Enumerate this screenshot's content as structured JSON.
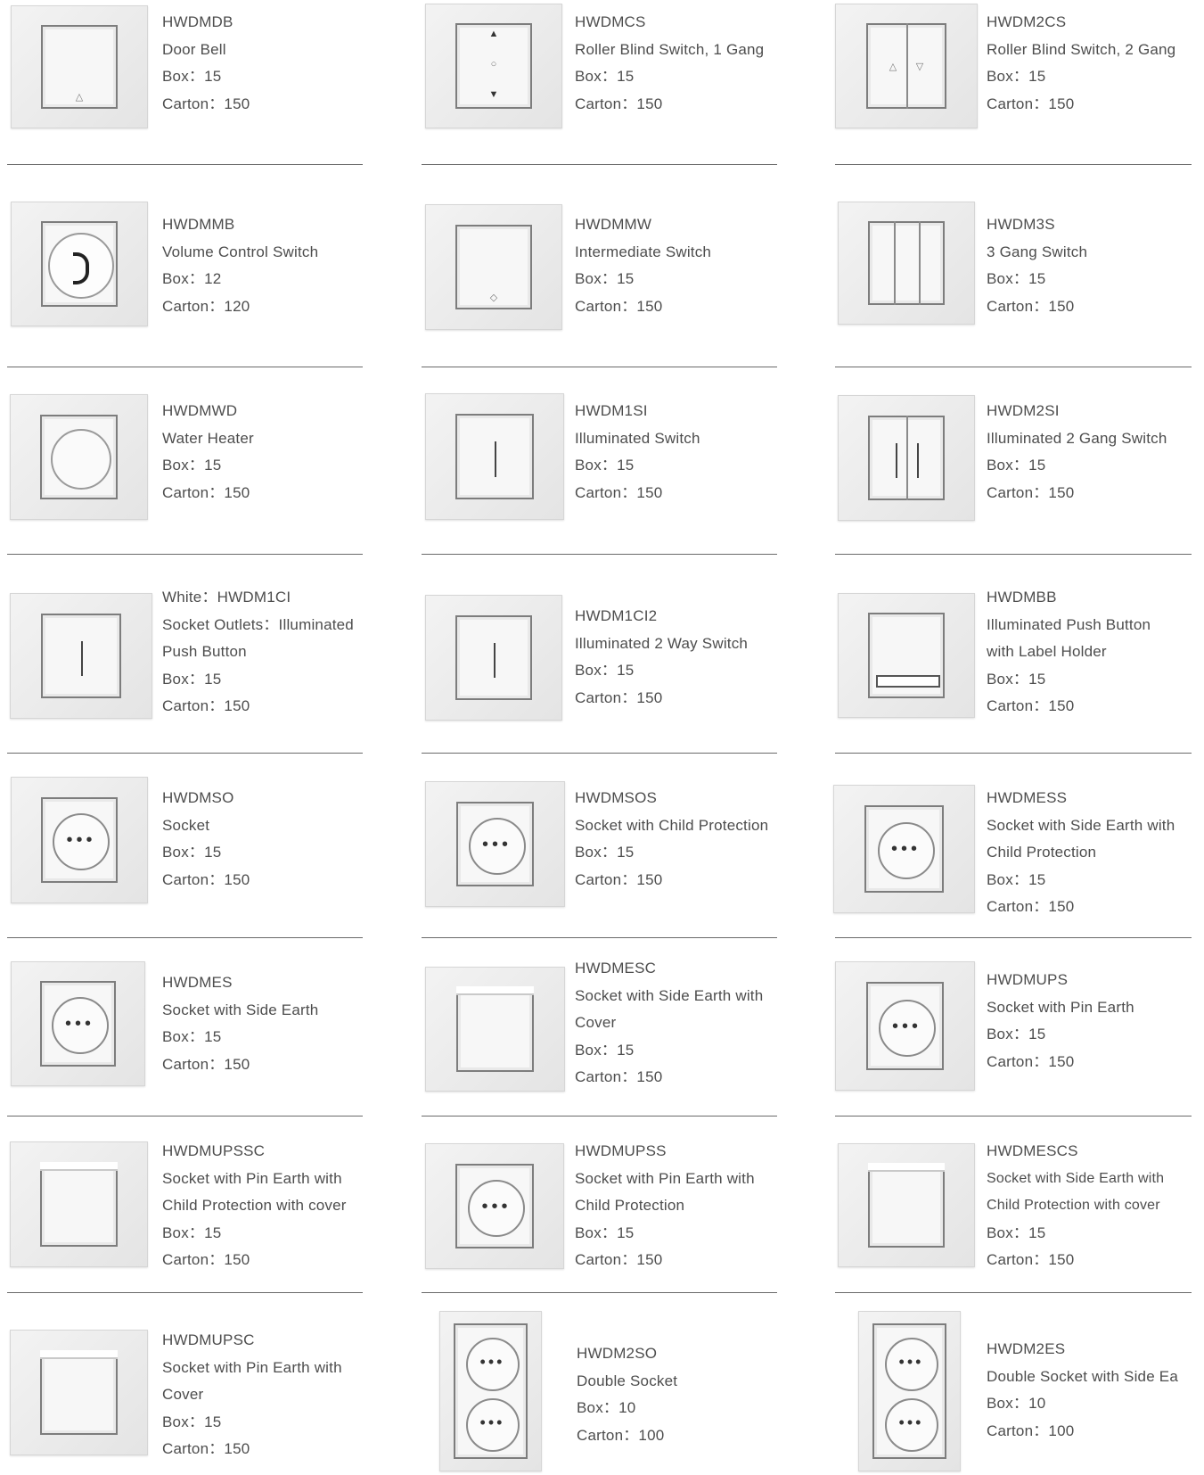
{
  "products": [
    {
      "code": "HWDMDB",
      "name": [
        "Door Bell"
      ],
      "box": "Box：15",
      "carton": "Carton：150",
      "icon": "door-bell-icon"
    },
    {
      "code": "HWDMCS",
      "name": [
        "Roller Blind Switch, 1 Gang"
      ],
      "box": "Box：15",
      "carton": "Carton：150",
      "icon": "roller-blind-1-gang-icon"
    },
    {
      "code": "HWDM2CS",
      "name": [
        "Roller Blind Switch, 2 Gang"
      ],
      "box": "Box：15",
      "carton": "Carton：150",
      "icon": "roller-blind-2-gang-icon"
    },
    {
      "code": "HWDMMB",
      "name": [
        "Volume Control Switch"
      ],
      "box": "Box：12",
      "carton": "Carton：120",
      "icon": "volume-control-dial-icon"
    },
    {
      "code": "HWDMMW",
      "name": [
        "Intermediate Switch"
      ],
      "box": "Box：15",
      "carton": "Carton：150",
      "icon": "intermediate-switch-icon"
    },
    {
      "code": "HWDM3S",
      "name": [
        "3 Gang Switch"
      ],
      "box": "Box：15",
      "carton": "Carton：150",
      "icon": "three-gang-switch-icon"
    },
    {
      "code": "HWDMWD",
      "name": [
        "Water Heater"
      ],
      "box": "Box：15",
      "carton": "Carton：150",
      "icon": "water-heater-knob-icon"
    },
    {
      "code": "HWDM1SI",
      "name": [
        "Illuminated Switch"
      ],
      "box": "Box：15",
      "carton": "Carton：150",
      "icon": "illuminated-switch-icon"
    },
    {
      "code": "HWDM2SI",
      "name": [
        "Illuminated 2 Gang Switch"
      ],
      "box": "Box：15",
      "carton": "Carton：150",
      "icon": "illuminated-2-gang-switch-icon"
    },
    {
      "code": "White：HWDM1CI",
      "name": [
        "Socket Outlets：Illuminated",
        "Push Button"
      ],
      "box": "Box：15",
      "carton": "Carton：150",
      "icon": "illuminated-push-button-icon"
    },
    {
      "code": "HWDM1CI2",
      "name": [
        "Illuminated 2 Way Switch"
      ],
      "box": "Box：15",
      "carton": "Carton：150",
      "icon": "illuminated-2-way-switch-icon"
    },
    {
      "code": "HWDMBB",
      "name": [
        "Illuminated Push Button",
        "with Label Holder"
      ],
      "box": "Box：15",
      "carton": "Carton：150",
      "icon": "push-button-label-holder-icon"
    },
    {
      "code": "HWDMSO",
      "name": [
        "Socket"
      ],
      "box": "Box：15",
      "carton": "Carton：150",
      "icon": "socket-icon"
    },
    {
      "code": "HWDMSOS",
      "name": [
        "Socket with Child Protection"
      ],
      "box": "Box：15",
      "carton": "Carton：150",
      "icon": "socket-child-protection-icon"
    },
    {
      "code": "HWDMESS",
      "name": [
        "Socket with Side Earth with",
        "Child Protection"
      ],
      "box": "Box：15",
      "carton": "Carton：150",
      "icon": "side-earth-child-protection-socket-icon"
    },
    {
      "code": "HWDMES",
      "name": [
        "Socket with Side Earth"
      ],
      "box": "Box：15",
      "carton": "Carton：150",
      "icon": "side-earth-socket-icon"
    },
    {
      "code": "HWDMESC",
      "name": [
        "Socket with Side Earth with",
        "Cover"
      ],
      "box": "Box：15",
      "carton": "Carton：150",
      "icon": "side-earth-cover-socket-icon"
    },
    {
      "code": "HWDMUPS",
      "name": [
        "Socket with Pin Earth"
      ],
      "box": "Box：15",
      "carton": "Carton：150",
      "icon": "pin-earth-socket-icon"
    },
    {
      "code": "HWDMUPSSC",
      "name": [
        "Socket with Pin Earth with",
        "Child Protection with cover"
      ],
      "box": "Box：15",
      "carton": "Carton：150",
      "icon": "pin-earth-child-cover-socket-icon"
    },
    {
      "code": "HWDMUPSS",
      "name": [
        "Socket with Pin Earth with",
        "Child Protection"
      ],
      "box": "Box：15",
      "carton": "Carton：150",
      "icon": "pin-earth-child-socket-icon"
    },
    {
      "code": "HWDMESCS",
      "name": [
        "Socket with Side Earth with",
        "Child Protection with cover"
      ],
      "box": "Box：15",
      "carton": "Carton：150",
      "icon": "side-earth-child-cover-socket-icon"
    },
    {
      "code": "HWDMUPSC",
      "name": [
        "Socket with Pin Earth with",
        "Cover"
      ],
      "box": "Box：15",
      "carton": "Carton：150",
      "icon": "pin-earth-cover-socket-icon"
    },
    {
      "code": "HWDM2SO",
      "name": [
        "Double Socket"
      ],
      "box": "Box：10",
      "carton": "Carton：100",
      "icon": "double-socket-icon"
    },
    {
      "code": "HWDM2ES",
      "name": [
        "Double Socket with Side Ea"
      ],
      "box": "Box：10",
      "carton": "Carton：100",
      "icon": "double-side-earth-socket-icon"
    }
  ]
}
